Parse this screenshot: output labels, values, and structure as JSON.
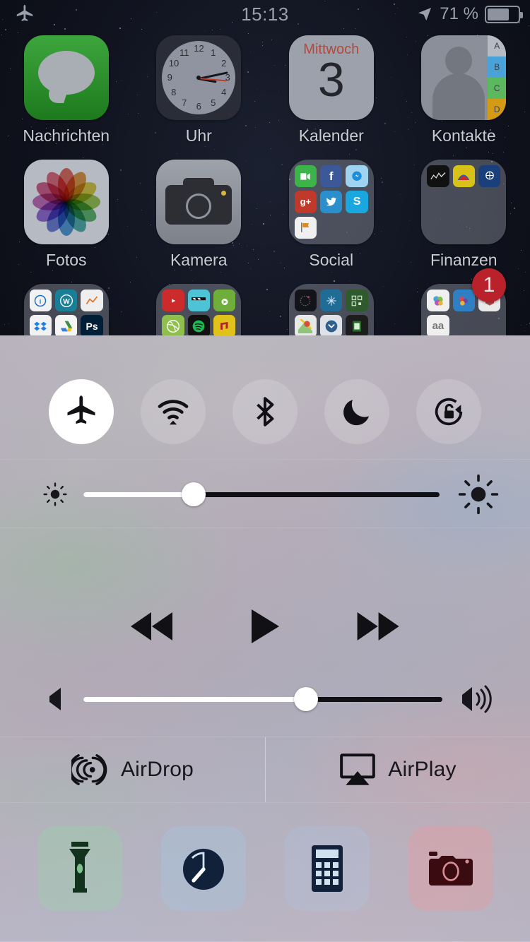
{
  "status_bar": {
    "airplane_icon": "airplane-icon",
    "time": "15:13",
    "location_icon": "location-arrow-icon",
    "battery_percent": "71 %",
    "battery_level": 71
  },
  "home_screen": {
    "rows": [
      [
        {
          "label": "Nachrichten",
          "icon": "messages-icon"
        },
        {
          "label": "Uhr",
          "icon": "clock-icon"
        },
        {
          "label": "Kalender",
          "icon": "calendar-icon",
          "weekday": "Mittwoch",
          "day": "3"
        },
        {
          "label": "Kontakte",
          "icon": "contacts-icon",
          "index_letters": [
            "A",
            "B",
            "C",
            "D"
          ]
        }
      ],
      [
        {
          "label": "Fotos",
          "icon": "photos-icon"
        },
        {
          "label": "Kamera",
          "icon": "camera-icon"
        },
        {
          "label": "Social",
          "icon": "folder-icon"
        },
        {
          "label": "Finanzen",
          "icon": "folder-icon",
          "badge": "1"
        }
      ],
      [
        {
          "label": "",
          "icon": "folder-icon"
        },
        {
          "label": "",
          "icon": "folder-icon"
        },
        {
          "label": "",
          "icon": "folder-icon"
        },
        {
          "label": "",
          "icon": "folder-icon"
        }
      ]
    ],
    "clock": {
      "hour_angle": 100,
      "minute_angle": 78,
      "second_angle": 95,
      "numerals": [
        "12",
        "1",
        "2",
        "3",
        "4",
        "5",
        "6",
        "7",
        "8",
        "9",
        "10",
        "11"
      ]
    },
    "social_folder_apps": [
      "facetime",
      "facebook",
      "messenger",
      "googleplus",
      "twitter",
      "skype",
      "flag"
    ],
    "finanzen_folder_apps": [
      "stocks",
      "wallet",
      "bank"
    ],
    "badge_color": "#b9222a"
  },
  "control_center": {
    "toggles": [
      {
        "name": "airplane-mode",
        "icon": "airplane-icon",
        "active": true
      },
      {
        "name": "wifi",
        "icon": "wifi-icon",
        "active": false
      },
      {
        "name": "bluetooth",
        "icon": "bluetooth-icon",
        "active": false
      },
      {
        "name": "do-not-disturb",
        "icon": "moon-icon",
        "active": false
      },
      {
        "name": "rotation-lock",
        "icon": "rotation-lock-icon",
        "active": false
      }
    ],
    "brightness": {
      "name": "brightness-slider",
      "value": 31,
      "min_icon": "sun-small-icon",
      "max_icon": "sun-large-icon"
    },
    "media": {
      "rewind": "rewind-icon",
      "play": "play-icon",
      "forward": "fast-forward-icon",
      "state": "paused"
    },
    "volume": {
      "name": "volume-slider",
      "value": 62,
      "min_icon": "speaker-mute-icon",
      "max_icon": "speaker-loud-icon"
    },
    "airdrop": {
      "label": "AirDrop",
      "icon": "airdrop-icon"
    },
    "airplay": {
      "label": "AirPlay",
      "icon": "airplay-icon"
    },
    "shortcuts": [
      {
        "name": "flashlight",
        "icon": "flashlight-icon",
        "tint": "#2e6b3f"
      },
      {
        "name": "timer",
        "icon": "timer-icon",
        "tint": "#15253f"
      },
      {
        "name": "calculator",
        "icon": "calculator-icon",
        "tint": "#15253f"
      },
      {
        "name": "camera",
        "icon": "camera-icon",
        "tint": "#3a0b10"
      }
    ]
  }
}
